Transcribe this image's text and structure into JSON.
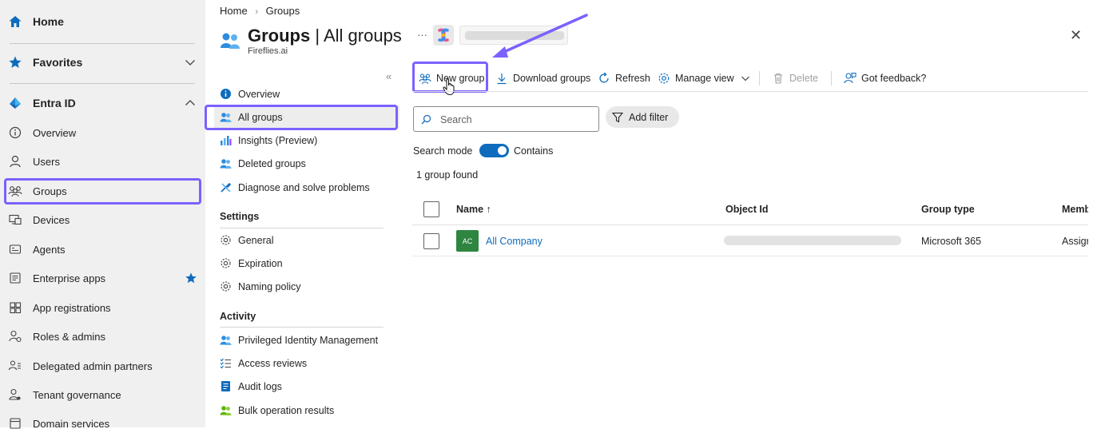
{
  "left_nav": {
    "home": "Home",
    "favorites": "Favorites",
    "entra_id": "Entra ID",
    "items": [
      "Overview",
      "Users",
      "Groups",
      "Devices",
      "Agents",
      "Enterprise apps",
      "App registrations",
      "Roles & admins",
      "Delegated admin partners",
      "Tenant governance",
      "Domain services"
    ]
  },
  "breadcrumb": {
    "home": "Home",
    "sep": "›",
    "current": "Groups"
  },
  "header": {
    "title_bold": "Groups",
    "title_sep": " | ",
    "title_rest": "All groups",
    "org": "Fireflies.ai",
    "more": "···",
    "close": "✕",
    "collapse": "«"
  },
  "blade_menu": {
    "items": [
      "Overview",
      "All groups",
      "Insights (Preview)",
      "Deleted groups",
      "Diagnose and solve problems"
    ],
    "settings_header": "Settings",
    "settings": [
      "General",
      "Expiration",
      "Naming policy"
    ],
    "activity_header": "Activity",
    "activity": [
      "Privileged Identity Management",
      "Access reviews",
      "Audit logs",
      "Bulk operation results"
    ]
  },
  "toolbar": {
    "new_group": "New group",
    "download": "Download groups",
    "refresh": "Refresh",
    "manage_view": "Manage view",
    "delete": "Delete",
    "feedback": "Got feedback?"
  },
  "search": {
    "placeholder": "Search",
    "add_filter": "Add filter",
    "mode_label": "Search mode",
    "mode_value": "Contains"
  },
  "results": {
    "count": "1 group found"
  },
  "table": {
    "headers": {
      "name": "Name ↑",
      "object_id": "Object Id",
      "group_type": "Group type",
      "membership": "Memb"
    },
    "rows": [
      {
        "initials": "AC",
        "name": "All Company",
        "group_type": "Microsoft 365",
        "membership": "Assigr"
      }
    ]
  },
  "colors": {
    "accent": "#0f6cbd",
    "highlight": "#7b61ff",
    "avatar": "#2e8540"
  }
}
